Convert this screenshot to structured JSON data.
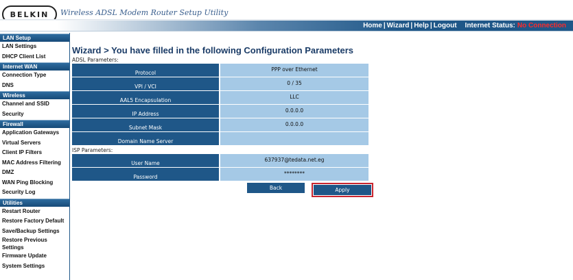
{
  "header": {
    "logo_text": "BELKIN",
    "tagline": "Wireless ADSL Modem Router Setup Utility"
  },
  "nav": {
    "links": [
      "Home",
      "Wizard",
      "Help",
      "Logout"
    ],
    "status_label": "Internet Status:",
    "status_value": "No Connection"
  },
  "sidebar": {
    "sections": [
      {
        "title": "LAN Setup",
        "items": [
          "LAN Settings",
          "DHCP Client List"
        ]
      },
      {
        "title": "Internet WAN",
        "items": [
          "Connection Type",
          "DNS"
        ]
      },
      {
        "title": "Wireless",
        "items": [
          "Channel and SSID",
          "Security"
        ]
      },
      {
        "title": "Firewall",
        "items": [
          "Application Gateways",
          "Virtual Servers",
          "Client IP Filters",
          "MAC Address Filtering",
          "DMZ",
          "WAN Ping Blocking",
          "Security Log"
        ]
      },
      {
        "title": "Utilities",
        "items": [
          "Restart Router",
          "Restore Factory Default",
          "Save/Backup Settings",
          "Restore Previous Settings",
          "Firmware Update",
          "System Settings"
        ]
      }
    ]
  },
  "main": {
    "title": "Wizard > You have filled in the following Configuration Parameters",
    "adsl_label": "ADSL Parameters:",
    "adsl_rows": [
      {
        "label": "Protocol",
        "value": "PPP over Ethernet"
      },
      {
        "label": "VPI / VCI",
        "value": "0 / 35"
      },
      {
        "label": "AAL5 Encapsulation",
        "value": "LLC"
      },
      {
        "label": "IP Address",
        "value": "0.0.0.0"
      },
      {
        "label": "Subnet Mask",
        "value": "0.0.0.0"
      },
      {
        "label": "Domain Name Server",
        "value": ""
      }
    ],
    "isp_label": "ISP Parameters:",
    "isp_rows": [
      {
        "label": "User Name",
        "value": "637937@tedata.net.eg"
      },
      {
        "label": "Password",
        "value": "********"
      }
    ],
    "back_label": "Back",
    "apply_label": "Apply"
  },
  "colors": {
    "brand_blue": "#1f5788",
    "value_blue": "#a5c9e6",
    "status_red": "#ff2a2a",
    "apply_highlight": "#c8242e"
  }
}
